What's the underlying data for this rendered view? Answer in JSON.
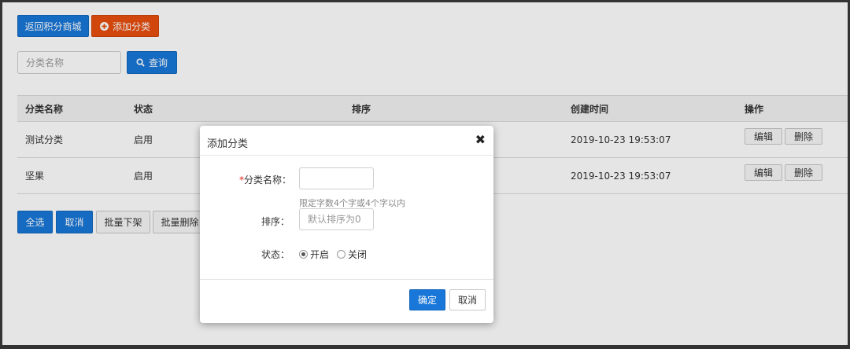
{
  "toolbar": {
    "back_label": "返回积分商城",
    "add_icon": "plus-circle-icon",
    "add_label": "添加分类"
  },
  "search": {
    "placeholder": "分类名称",
    "value": "",
    "button_label": "查询",
    "icon": "search-icon"
  },
  "table": {
    "headers": [
      "分类名称",
      "状态",
      "排序",
      "创建时间",
      "操作"
    ],
    "rows": [
      {
        "name": "测试分类",
        "status": "启用",
        "sort": "",
        "created": "2019-10-23 19:53:07",
        "edit": "编辑",
        "delete": "删除"
      },
      {
        "name": "坚果",
        "status": "启用",
        "sort": "",
        "created": "2019-10-23 19:53:07",
        "edit": "编辑",
        "delete": "删除"
      }
    ]
  },
  "bulk": {
    "select_all": "全选",
    "cancel": "取消",
    "batch_off": "批量下架",
    "batch_delete": "批量删除"
  },
  "modal": {
    "title": "添加分类",
    "close_icon": "close-icon",
    "name_required_mark": "*",
    "name_label": "分类名称：",
    "name_value": "",
    "name_hint": "限定字数4个字或4个字以内",
    "sort_label": "排序：",
    "sort_placeholder": "默认排序为0",
    "status_label": "状态：",
    "status_options": [
      "开启",
      "关闭"
    ],
    "status_selected": "开启",
    "confirm_label": "确定",
    "cancel_label": "取消"
  },
  "colors": {
    "primary": "#1877d8",
    "accent": "#e84e0f"
  }
}
